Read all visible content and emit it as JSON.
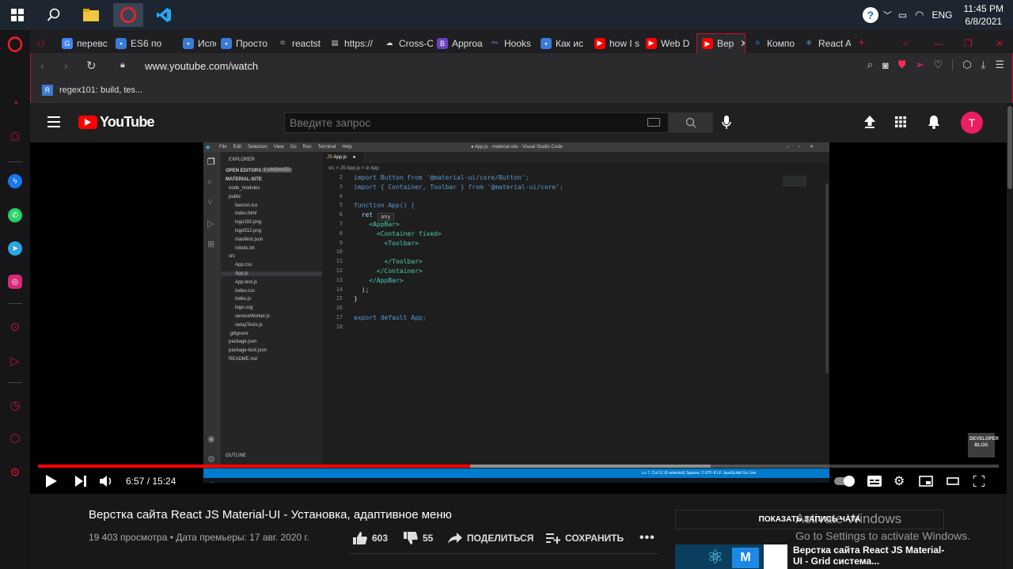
{
  "taskbar": {
    "tray": {
      "language": "ENG",
      "time": "11:45 PM",
      "date": "6/8/2021"
    }
  },
  "tabs": [
    {
      "label": "перевс",
      "color": "#4285f4",
      "icon": "google-icon"
    },
    {
      "label": "ES6 по",
      "color": "#3a7bd5",
      "icon": "bookmark-icon"
    },
    {
      "label": "Исполь",
      "color": "#3a7bd5",
      "icon": "bookmark-icon"
    },
    {
      "label": "Просто",
      "color": "#3a7bd5",
      "icon": "bookmark-icon"
    },
    {
      "label": "reactst",
      "color": "#888888",
      "icon": "gear-icon"
    },
    {
      "label": "https://",
      "color": "#dddddd",
      "icon": "document-icon"
    },
    {
      "label": "Cross-C",
      "color": "#dddddd",
      "icon": "cloud-icon"
    },
    {
      "label": "Approa",
      "color": "#6f42c1",
      "icon": "b-icon"
    },
    {
      "label": "Hooks",
      "color": "#9b6ad8",
      "icon": "hooks-icon"
    },
    {
      "label": "Как ис",
      "color": "#3a7bd5",
      "icon": "bookmark-icon"
    },
    {
      "label": "how I s",
      "color": "#ff0000",
      "icon": "youtube-icon"
    },
    {
      "label": "Web D",
      "color": "#ff0000",
      "icon": "youtube-icon"
    },
    {
      "label": "Вер",
      "color": "#ff0000",
      "icon": "youtube-icon"
    },
    {
      "label": "Компо",
      "color": "#1e88e5",
      "icon": "react-icon"
    },
    {
      "label": "React A",
      "color": "#61dafb",
      "icon": "react-icon"
    }
  ],
  "address": {
    "url": "www.youtube.com/watch"
  },
  "bookmarks": [
    {
      "label": "regex101: build, tes...",
      "badge": "R"
    }
  ],
  "youtube": {
    "logo": "YouTube",
    "search_placeholder": "Введите запрос",
    "avatar_letter": "T",
    "video": {
      "title": "Верстка сайта React JS Material-UI - Установка, адаптивное меню",
      "views": "19 403 просмотра",
      "premiere": "Дата премьеры: 17 авг. 2020 г.",
      "likes": "603",
      "dislikes": "55",
      "share": "ПОДЕЛИТЬСЯ",
      "save": "СОХРАНИТЬ",
      "time_current": "6:57",
      "time_total": "15:24",
      "time_display": "6:57 / 15:24",
      "progress": 0.45
    },
    "show_chat": "ПОКАЗАТЬ ЗАПИСЬ ЧАТА",
    "recommended": {
      "title": "Верстка сайта React JS Material-UI - Grid система..."
    }
  },
  "vscode": {
    "title": "● App.js - material-site - Visual Studio Code",
    "menu": [
      "File",
      "Edit",
      "Selection",
      "View",
      "Go",
      "Run",
      "Terminal",
      "Help"
    ],
    "explorer_label": "EXPLORER",
    "open_editors": "OPEN EDITORS",
    "unsaved": "1 UNSAVED",
    "project": "MATERIAL-SITE",
    "tree": [
      "node_modules",
      "public",
      "favicon.ico",
      "index.html",
      "logo192.png",
      "logo512.png",
      "manifest.json",
      "robots.txt",
      "src",
      "App.css",
      "App.js",
      "App.test.js",
      "index.css",
      "index.js",
      "logo.svg",
      "serviceWorker.js",
      "setupTests.js",
      ".gitignore",
      "package.json",
      "package-lock.json",
      "README.md"
    ],
    "outline": "OUTLINE",
    "tab": "App.js",
    "breadcrumb": "src > JS App.js > ⊘ App",
    "code": [
      {
        "n": "2",
        "text": "import Button from '@material-ui/core/Button';"
      },
      {
        "n": "3",
        "text": "import { Container, Toolbar } from '@material-ui/core';"
      },
      {
        "n": "4",
        "text": ""
      },
      {
        "n": "5",
        "text": "function App() {"
      },
      {
        "n": "6",
        "text": "  ret"
      },
      {
        "n": "7",
        "text": "    <AppBar>"
      },
      {
        "n": "8",
        "text": "      <Container fixed>"
      },
      {
        "n": "9",
        "text": "        <Toolbar>"
      },
      {
        "n": "10",
        "text": ""
      },
      {
        "n": "11",
        "text": "        </Toolbar>"
      },
      {
        "n": "12",
        "text": "      </Container>"
      },
      {
        "n": "13",
        "text": "    </AppBar>"
      },
      {
        "n": "14",
        "text": "  );"
      },
      {
        "n": "15",
        "text": "}"
      },
      {
        "n": "16",
        "text": ""
      },
      {
        "n": "17",
        "text": "export default App;"
      },
      {
        "n": "18",
        "text": ""
      }
    ],
    "tooltip": "any",
    "status_right": "Ln 7, Col 12 (6 selected)   Spaces: 2   UTF-8   LF   JavaScript   Go Live",
    "watermark": "DEVELOPER BLOG"
  },
  "windows_activation": {
    "title": "Activate Windows",
    "subtitle": "Go to Settings to activate Windows."
  }
}
